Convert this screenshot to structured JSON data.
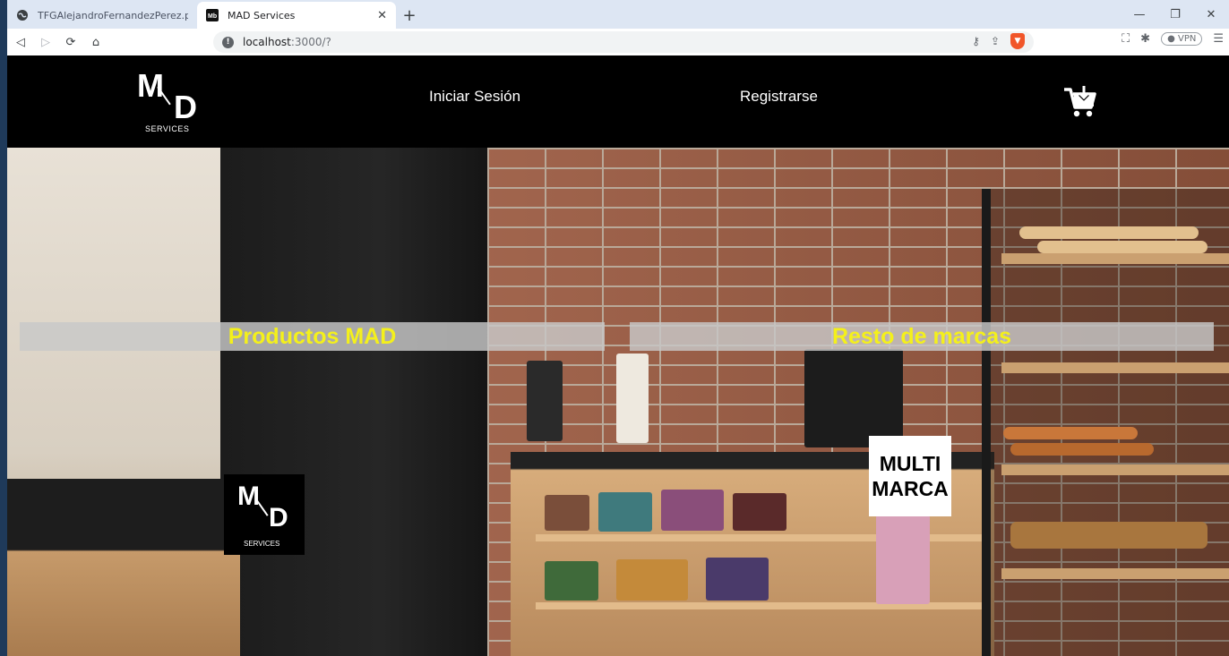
{
  "browser": {
    "tabs": [
      {
        "title": "TFGAlejandroFernandezPerez.pdf",
        "active": false
      },
      {
        "title": "MAD Services",
        "active": true
      }
    ],
    "new_tab_label": "+",
    "url_host": "localhost",
    "url_rest": ":3000/?",
    "vpn_label": "VPN"
  },
  "site": {
    "logo": {
      "m": "M",
      "d": "D",
      "sub": "SERVICES"
    },
    "nav": {
      "login": "Iniciar Sesión",
      "register": "Registrarse"
    },
    "categories": [
      {
        "label": "Productos MAD"
      },
      {
        "label": "Resto de marcas"
      }
    ],
    "mad_logo": {
      "m": "M",
      "d": "D",
      "sub": "SERVICES"
    },
    "multimarca_logo": {
      "line1": "MULTI",
      "line2": "MARCA"
    }
  },
  "colors": {
    "header_bg": "#000000",
    "category_text": "#f4f01b",
    "category_bg": "#c8c8c8"
  }
}
